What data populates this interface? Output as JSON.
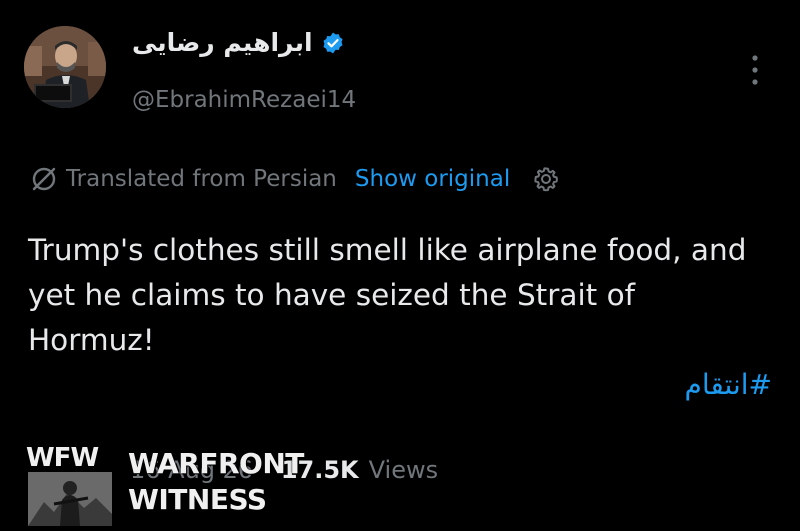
{
  "profile": {
    "display_name": "ابراهیم رضایی",
    "handle": "@EbrahimRezaei14",
    "verified": true
  },
  "translation": {
    "label": "Translated from Persian",
    "show_original": "Show original"
  },
  "tweet": {
    "text": "Trump's clothes still smell like airplane food, and yet he claims to have seized the Strait of Hormuz!",
    "hashtag": "#انتقام"
  },
  "meta": {
    "date": "16 Aug 26",
    "separator": "·",
    "views_count": "17.5K",
    "views_label": "Views"
  },
  "watermark": {
    "logo_text": "WFW",
    "line1": "WARFRONT",
    "line2": "WITNESS"
  },
  "colors": {
    "background": "#000000",
    "text_primary": "#e7e9ea",
    "text_muted": "#71767b",
    "accent": "#1d9bf0"
  },
  "icons": [
    "verified-badge-icon",
    "more-options-icon",
    "translate-icon",
    "settings-gear-icon"
  ]
}
